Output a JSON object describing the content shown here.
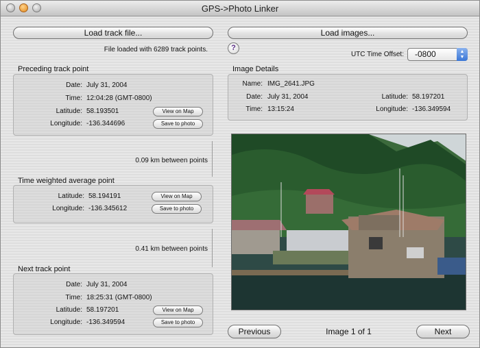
{
  "window": {
    "title": "GPS->Photo Linker"
  },
  "left": {
    "load_track_label": "Load track file...",
    "file_status": "File loaded with 6289 track points.",
    "preceding": {
      "heading": "Preceding track point",
      "date_label": "Date:",
      "date": "July 31, 2004",
      "time_label": "Time:",
      "time": "12:04:28 (GMT-0800)",
      "lat_label": "Latitude:",
      "lat": "58.193501",
      "lon_label": "Longitude:",
      "lon": "-136.344696",
      "view_map": "View on Map",
      "save_photo": "Save to photo"
    },
    "dist1": "0.09 km between points",
    "weighted": {
      "heading": "Time weighted average point",
      "lat_label": "Latitude:",
      "lat": "58.194191",
      "lon_label": "Longitude:",
      "lon": "-136.345612",
      "view_map": "View on Map",
      "save_photo": "Save to photo"
    },
    "dist2": "0.41 km between points",
    "next": {
      "heading": "Next track point",
      "date_label": "Date:",
      "date": "July 31, 2004",
      "time_label": "Time:",
      "time": "18:25:31 (GMT-0800)",
      "lat_label": "Latitude:",
      "lat": "58.197201",
      "lon_label": "Longitude:",
      "lon": "-136.349594",
      "view_map": "View on Map",
      "save_photo": "Save to photo"
    }
  },
  "right": {
    "load_images_label": "Load images...",
    "help_symbol": "?",
    "utc_label": "UTC Time Offset:",
    "utc_value": "-0800",
    "image_details": {
      "heading": "Image Details",
      "name_label": "Name:",
      "name": "IMG_2641.JPG",
      "date_label": "Date:",
      "date": "July 31, 2004",
      "time_label": "Time:",
      "time": "13:15:24",
      "lat_label": "Latitude:",
      "lat": "58.197201",
      "lon_label": "Longitude:",
      "lon": "-136.349594"
    },
    "previous_label": "Previous",
    "image_counter": "Image 1 of 1",
    "next_label": "Next"
  },
  "colors": {
    "accent": "#3a76d6",
    "help": "#5a2d86"
  }
}
